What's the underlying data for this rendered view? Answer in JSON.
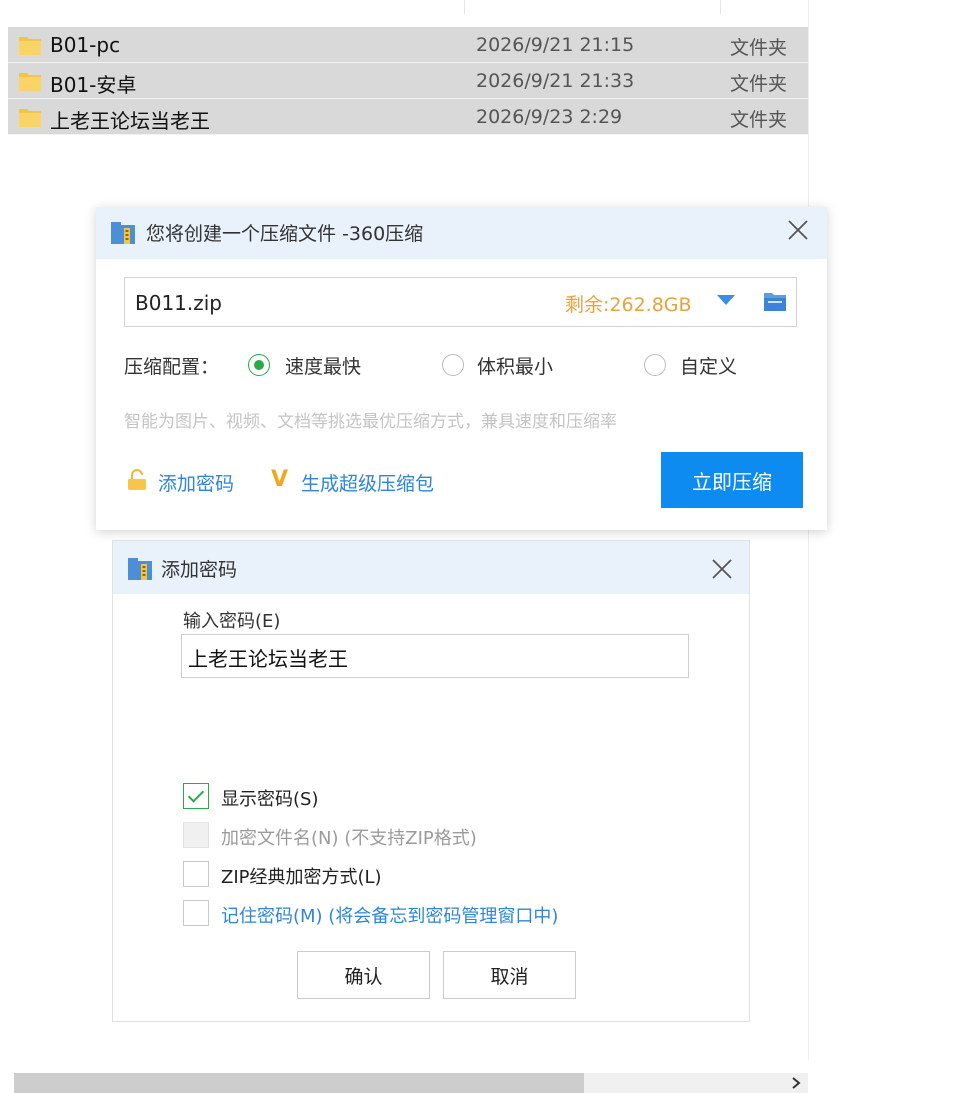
{
  "files": [
    {
      "name": "B01-pc",
      "date": "2026/9/21 21:15",
      "type": "文件夹"
    },
    {
      "name": "B01-安卓",
      "date": "2026/9/21 21:33",
      "type": "文件夹"
    },
    {
      "name": "上老王论坛当老王",
      "date": "2026/9/23 2:29",
      "type": "文件夹"
    }
  ],
  "compress_dialog": {
    "title": "您将创建一个压缩文件 -360压缩",
    "filename": "B011.zip",
    "free_space": "剩余:262.8GB",
    "config_label": "压缩配置：",
    "options": [
      {
        "label": "速度最快",
        "selected": true
      },
      {
        "label": "体积最小",
        "selected": false
      },
      {
        "label": "自定义",
        "selected": false
      }
    ],
    "hint": "智能为图片、视频、文档等挑选最优压缩方式，兼具速度和压缩率",
    "add_password": "添加密码",
    "super_package": "生成超级压缩包",
    "compress_button": "立即压缩"
  },
  "password_dialog": {
    "title": "添加密码",
    "input_label": "输入密码(E)",
    "password_value": "上老王论坛当老王",
    "checkboxes": [
      {
        "label": "显示密码(S)",
        "checked": true,
        "disabled": false
      },
      {
        "label": "加密文件名(N) (不支持ZIP格式)",
        "checked": false,
        "disabled": true
      },
      {
        "label": "ZIP经典加密方式(L)",
        "checked": false,
        "disabled": false
      },
      {
        "label": "记住密码(M) (将会备忘到密码管理窗口中)",
        "checked": false,
        "disabled": false
      }
    ],
    "confirm": "确认",
    "cancel": "取消"
  },
  "colors": {
    "accent_blue": "#0d8bf0",
    "link_blue": "#2f86d8",
    "check_green": "#2aa84a",
    "free_space_orange": "#e8a33d",
    "titlebar_bg": "#e9f1fb"
  }
}
